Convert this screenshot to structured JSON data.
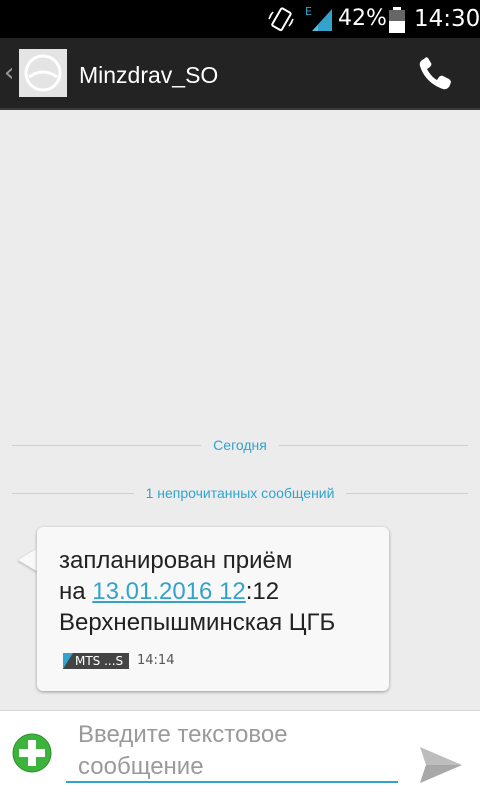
{
  "status_bar": {
    "network_label": "E",
    "battery_percent": "42%",
    "time": "14:30"
  },
  "action_bar": {
    "contact_name": "Minzdrav_SO",
    "back_glyph": "‹"
  },
  "conversation": {
    "today_label": "Сегодня",
    "unread_label": "1 непрочитанных сообщений",
    "message": {
      "line1": "запланирован приём",
      "line2_prefix": "на ",
      "line2_link": "13.01.2016 12",
      "line2_suffix": ":12",
      "line3": "Верхнепышминская ЦГБ",
      "sim_label": "MTS ...S",
      "time": "14:14"
    }
  },
  "compose": {
    "placeholder": "Введите текстовое сообщение"
  },
  "colors": {
    "accent": "#33a3cc",
    "add_button": "#3cb33c",
    "action_bar": "#232323"
  }
}
